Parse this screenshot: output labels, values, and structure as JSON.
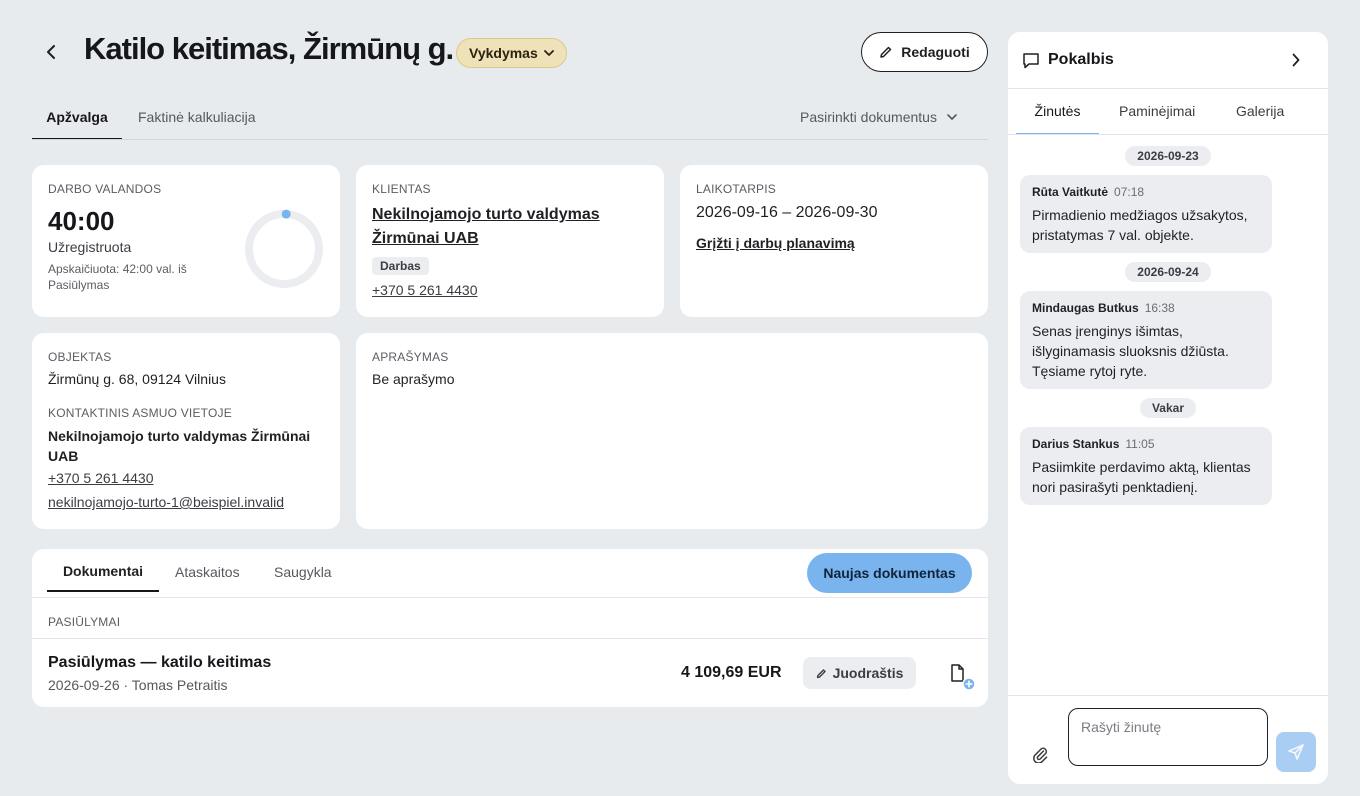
{
  "header": {
    "title": "Katilo keitimas, Žirmūnų g.",
    "status": "Vykdymas",
    "edit_label": "Redaguoti"
  },
  "tabs": [
    {
      "label": "Apžvalga",
      "active": true
    },
    {
      "label": "Faktinė kalkuliacija",
      "active": false
    }
  ],
  "doc_select_label": "Pasirinkti dokumentus",
  "hours_card": {
    "label": "DARBO VALANDOS",
    "value": "40:00",
    "registered": "Užregistruota",
    "calc_line1": "Apskaičiuota: 42:00 val. iš",
    "calc_line2": "Pasiūlymas",
    "progress": 0.01
  },
  "client_card": {
    "label": "KLIENTAS",
    "name_line1": "Nekilnojamojo turto valdymas",
    "name_line2": "Žirmūnai UAB",
    "tag": "Darbas",
    "phone": "+370 5 261 4430"
  },
  "period_card": {
    "label": "LAIKOTARPIS",
    "range": "2026-09-16 – 2026-09-30",
    "link": "Grįžti į darbų planavimą"
  },
  "object_card": {
    "label": "OBJEKTAS",
    "address": "Žirmūnų g. 68, 09124 Vilnius",
    "contact_label": "KONTAKTINIS ASMUO VIETOJE",
    "contact_line1": "Nekilnojamojo turto valdymas Žirmūnai",
    "contact_line2": "UAB",
    "phone": "+370 5 261 4430",
    "email": "nekilnojamojo-turto-1@beispiel.invalid"
  },
  "description_card": {
    "label": "APRAŠYMAS",
    "text": "Be aprašymo"
  },
  "documents": {
    "tabs": [
      {
        "label": "Dokumentai",
        "active": true
      },
      {
        "label": "Ataskaitos",
        "active": false
      },
      {
        "label": "Saugykla",
        "active": false
      }
    ],
    "new_button": "Naujas dokumentas",
    "section_label": "PASIŪLYMAI",
    "item": {
      "title": "Pasiūlymas — katilo keitimas",
      "meta": "2026-09-26 · Tomas Petraitis",
      "amount": "4 109,69 EUR",
      "status": "Juodraštis"
    }
  },
  "chat": {
    "title": "Pokalbis",
    "tabs": [
      {
        "label": "Žinutės",
        "active": true
      },
      {
        "label": "Paminėjimai",
        "active": false
      },
      {
        "label": "Galerija",
        "active": false
      }
    ],
    "groups": [
      {
        "date": "2026-09-23",
        "author": "Rūta Vaitkutė",
        "time": "07:18",
        "lines": [
          "Pirmadienio medžiagos užsakytos,",
          "pristatymas 7 val. objekte."
        ]
      },
      {
        "date": "2026-09-24",
        "author": "Mindaugas Butkus",
        "time": "16:38",
        "lines": [
          "Senas įrenginys išimtas,",
          "išlyginamasis sluoksnis džiūsta.",
          "Tęsiame rytoj ryte."
        ]
      },
      {
        "date": "Vakar",
        "author": "Darius Stankus",
        "time": "11:05",
        "lines": [
          "Pasiimkite perdavimo aktą, klientas",
          "nori pasirašyti penktadienį."
        ]
      }
    ],
    "input_placeholder": "Rašyti žinutę"
  }
}
